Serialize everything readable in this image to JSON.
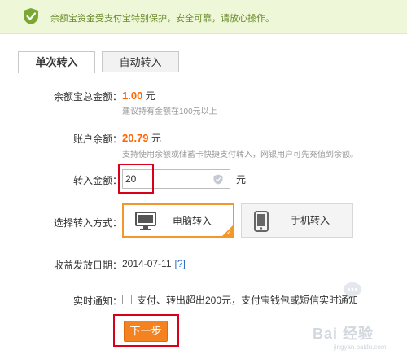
{
  "banner": {
    "text": "余额宝资金受支付宝特别保护，安全可靠，请放心操作。",
    "icon": "shield-check-icon",
    "bg_color": "#eef7d8",
    "text_color": "#6a8b2a"
  },
  "tabs": [
    {
      "label": "单次转入",
      "active": true
    },
    {
      "label": "自动转入",
      "active": false
    }
  ],
  "form": {
    "total_label": "余额宝总金额：",
    "total_amount": "1.00",
    "total_unit": "元",
    "total_hint": "建议持有金额在100元以上",
    "balance_label": "账户余额：",
    "balance_amount": "20.79",
    "balance_unit": "元",
    "balance_hint": "支持使用余额或储蓄卡快捷支付转入，网银用户可先充值到余额。",
    "transfer_label": "转入金额：",
    "transfer_value": "20",
    "transfer_unit": "元",
    "method_label": "选择转入方式：",
    "methods": [
      {
        "label": "电脑转入",
        "icon": "monitor-icon",
        "selected": true
      },
      {
        "label": "手机转入",
        "icon": "mobile-phone-icon",
        "selected": false
      }
    ],
    "date_label": "收益发放日期：",
    "date_value": "2014-07-11",
    "date_help": "[?]",
    "notify_label": "实时通知：",
    "notify_text": "支付、转出超出200元，支付宝钱包或短信实时通知"
  },
  "next_button": "下一步",
  "watermark": {
    "text": "Bai 经验",
    "sub": "jingyan.baidu.com"
  },
  "colors": {
    "accent": "#f58220",
    "amount": "#ff6600",
    "highlight_box": "#d9001b",
    "link": "#2b6fc4"
  }
}
